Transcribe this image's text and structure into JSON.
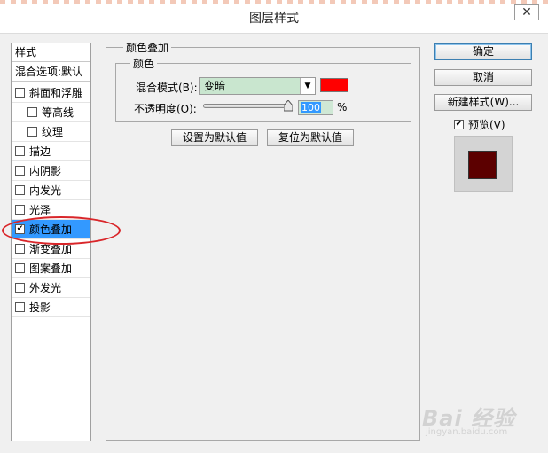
{
  "window": {
    "title": "图层样式",
    "close_label": "✕"
  },
  "style_list": {
    "header": "样式",
    "blend_options": "混合选项:默认",
    "items": [
      {
        "label": "斜面和浮雕",
        "checked": false,
        "sub": false
      },
      {
        "label": "等高线",
        "checked": false,
        "sub": true
      },
      {
        "label": "纹理",
        "checked": false,
        "sub": true
      },
      {
        "label": "描边",
        "checked": false,
        "sub": false
      },
      {
        "label": "内阴影",
        "checked": false,
        "sub": false
      },
      {
        "label": "内发光",
        "checked": false,
        "sub": false
      },
      {
        "label": "光泽",
        "checked": false,
        "sub": false
      },
      {
        "label": "颜色叠加",
        "checked": true,
        "sub": false,
        "selected": true
      },
      {
        "label": "渐变叠加",
        "checked": false,
        "sub": false
      },
      {
        "label": "图案叠加",
        "checked": false,
        "sub": false
      },
      {
        "label": "外发光",
        "checked": false,
        "sub": false
      },
      {
        "label": "投影",
        "checked": false,
        "sub": false
      }
    ]
  },
  "overlay": {
    "title": "颜色叠加",
    "group_title": "颜色",
    "blend_mode_label": "混合模式(B):",
    "blend_mode_value": "变暗",
    "overlay_color": "#ff0000",
    "opacity_label": "不透明度(O):",
    "opacity_value": "100",
    "opacity_unit": "%",
    "opacity_fraction": 1.0,
    "set_default_label": "设置为默认值",
    "reset_default_label": "复位为默认值"
  },
  "actions": {
    "ok_label": "确定",
    "cancel_label": "取消",
    "new_style_label": "新建样式(W)...",
    "preview_label": "预览(V)",
    "preview_checked": true
  },
  "watermark": {
    "text": "Bai 经验",
    "sub": "jingyan.baidu.com"
  },
  "colors": {
    "selected_row": "#3399ff",
    "highlight": "#d9262a",
    "preview": "#5c0000"
  }
}
